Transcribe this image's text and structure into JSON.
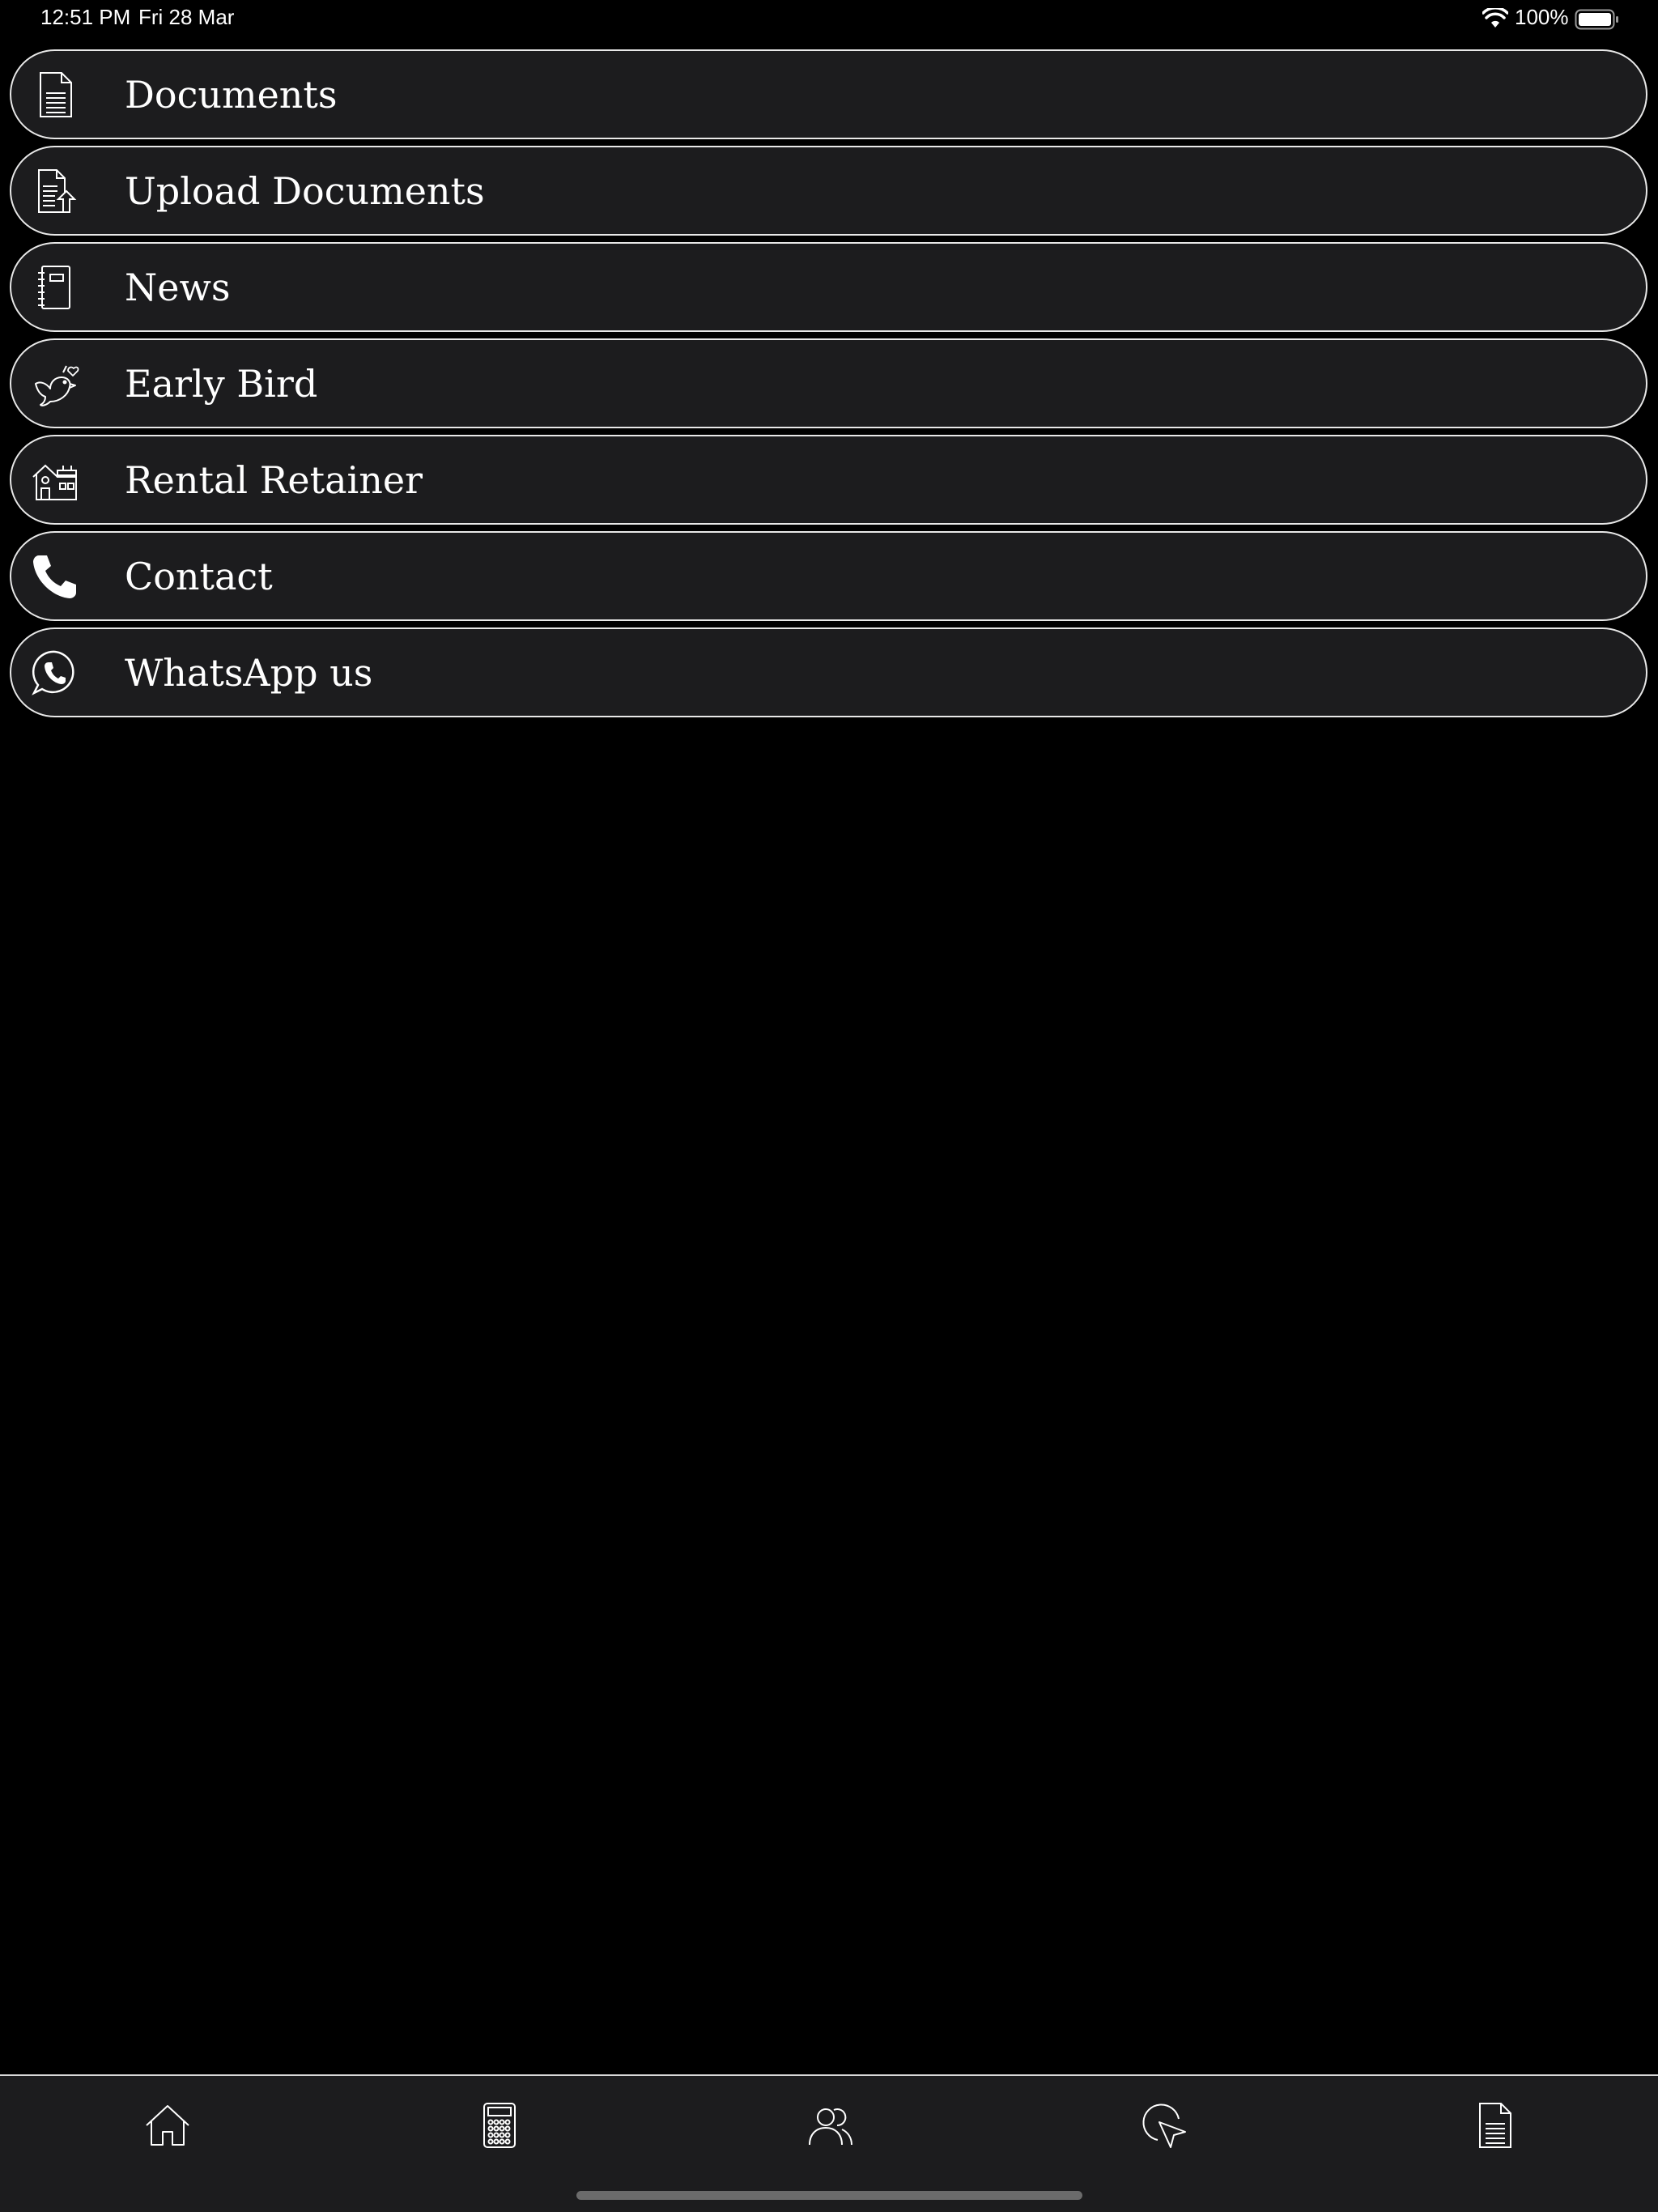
{
  "status_bar": {
    "time": "12:51 PM",
    "date": "Fri 28 Mar",
    "battery": "100%"
  },
  "menu": {
    "items": [
      {
        "label": "Documents",
        "icon": "document-icon"
      },
      {
        "label": "Upload Documents",
        "icon": "upload-document-icon"
      },
      {
        "label": "News",
        "icon": "notebook-icon"
      },
      {
        "label": "Early Bird",
        "icon": "bird-icon"
      },
      {
        "label": "Rental Retainer",
        "icon": "house-icon"
      },
      {
        "label": "Contact",
        "icon": "phone-icon"
      },
      {
        "label": "WhatsApp us",
        "icon": "whatsapp-icon"
      }
    ]
  },
  "tab_bar": {
    "tabs": [
      {
        "icon": "home-icon"
      },
      {
        "icon": "calculator-icon"
      },
      {
        "icon": "people-icon"
      },
      {
        "icon": "cursor-click-icon"
      },
      {
        "icon": "document-icon"
      }
    ]
  }
}
